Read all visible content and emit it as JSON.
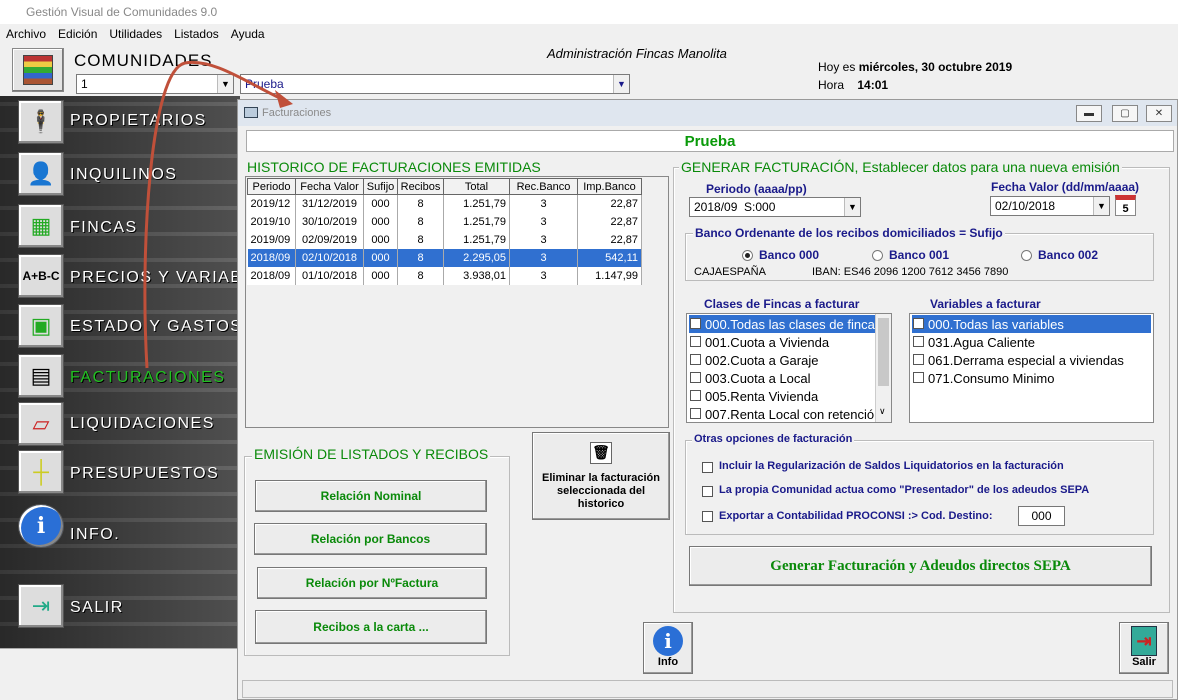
{
  "app": {
    "title": "Gestión Visual de Comunidades 9.0"
  },
  "menu": [
    "Archivo",
    "Edición",
    "Utilidades",
    "Listados",
    "Ayuda"
  ],
  "header": {
    "comunidades_label": "COMUNIDADES",
    "code_value": "1",
    "name_value": "Prueba",
    "admin_text": "Administración Fincas Manolita",
    "hoy_label": "Hoy es",
    "hoy_value": "miércoles, 30 octubre 2019",
    "hora_label": "Hora",
    "hora_value": "14:01"
  },
  "sidebar": {
    "items": [
      {
        "label": "PROPIETARIOS",
        "icon": "person-icon"
      },
      {
        "label": "INQUILINOS",
        "icon": "tenant-icon"
      },
      {
        "label": "FINCAS",
        "icon": "building-icon"
      },
      {
        "label": "PRECIOS Y VARIABLES",
        "icon": "abc-icon"
      },
      {
        "label": "ESTADO Y GASTOS",
        "icon": "monitor-icon"
      },
      {
        "label": "FACTURACIONES",
        "icon": "invoice-icon"
      },
      {
        "label": "LIQUIDACIONES",
        "icon": "ledger-icon"
      },
      {
        "label": "PRESUPUESTOS",
        "icon": "ruler-icon"
      },
      {
        "label": "INFO.",
        "icon": "info-icon"
      },
      {
        "label": "SALIR",
        "icon": "exit-door-icon"
      }
    ],
    "active_color": "#22c022"
  },
  "child": {
    "title": "Facturaciones",
    "comunidad": "Prueba",
    "historico": {
      "title": "HISTORICO DE FACTURACIONES EMITIDAS",
      "columns": [
        "Periodo",
        "Fecha Valor",
        "Sufijo",
        "Recibos",
        "Total",
        "Rec.Banco",
        "Imp.Banco"
      ],
      "rows": [
        [
          "2019/12",
          "31/12/2019",
          "000",
          "8",
          "1.251,79",
          "3",
          "22,87"
        ],
        [
          "2019/10",
          "30/10/2019",
          "000",
          "8",
          "1.251,79",
          "3",
          "22,87"
        ],
        [
          "2019/09",
          "02/09/2019",
          "000",
          "8",
          "1.251,79",
          "3",
          "22,87"
        ],
        [
          "2018/09",
          "02/10/2018",
          "000",
          "8",
          "2.295,05",
          "3",
          "542,11"
        ],
        [
          "2018/09",
          "01/10/2018",
          "000",
          "8",
          "3.938,01",
          "3",
          "1.147,99"
        ]
      ],
      "selected_row": 3
    },
    "emision": {
      "title": "EMISIÓN DE LISTADOS Y RECIBOS",
      "buttons": [
        "Relación Nominal",
        "Relación por Bancos",
        "Relación por NºFactura",
        "Recibos a la carta ..."
      ]
    },
    "eliminar_label": "Eliminar la facturación seleccionada del historico",
    "generar": {
      "title": "GENERAR FACTURACIÓN, Establecer datos para una nueva emisión",
      "periodo_label": "Periodo (aaaa/pp)",
      "periodo_value": "2018/09  S:000",
      "fecha_label": "Fecha Valor (dd/mm/aaaa)",
      "fecha_value": "02/10/2018",
      "calendar_day": "5",
      "banco_legend": "Banco Ordenante de los recibos domiciliados = Sufijo",
      "bancos": [
        "Banco 000",
        "Banco 001",
        "Banco 002"
      ],
      "banco_selected": 0,
      "banco_name": "CAJAESPAÑA",
      "iban": "IBAN: ES46 2096 1200 7612 3456 7890",
      "clases_label": "Clases de Fincas a facturar",
      "clases": [
        {
          "label": "000.Todas las clases de finca",
          "checked": true,
          "selected": true
        },
        {
          "label": "001.Cuota a Vivienda",
          "checked": false
        },
        {
          "label": "002.Cuota a Garaje",
          "checked": false
        },
        {
          "label": "003.Cuota a Local",
          "checked": false
        },
        {
          "label": "005.Renta Vivienda",
          "checked": false
        },
        {
          "label": "007.Renta Local con retenció",
          "checked": false
        }
      ],
      "variables_label": "Variables a facturar",
      "variables": [
        {
          "label": "000.Todas las variables",
          "checked": true,
          "selected": true
        },
        {
          "label": "031.Agua Caliente",
          "checked": false
        },
        {
          "label": "061.Derrama especial a viviendas",
          "checked": false
        },
        {
          "label": "071.Consumo Minimo",
          "checked": false
        }
      ],
      "otras_legend": "Otras opciones de facturación",
      "opciones": [
        "Incluir la Regularización de Saldos Liquidatorios en la facturación",
        "La propia Comunidad actua como \"Presentador\" de los adeudos SEPA",
        "Exportar a Contabilidad PROCONSI :> Cod. Destino:"
      ],
      "cod_destino": "000",
      "generar_button": "Generar Facturación y Adeudos directos SEPA"
    },
    "info_button": "Info",
    "salir_button": "Salir"
  }
}
